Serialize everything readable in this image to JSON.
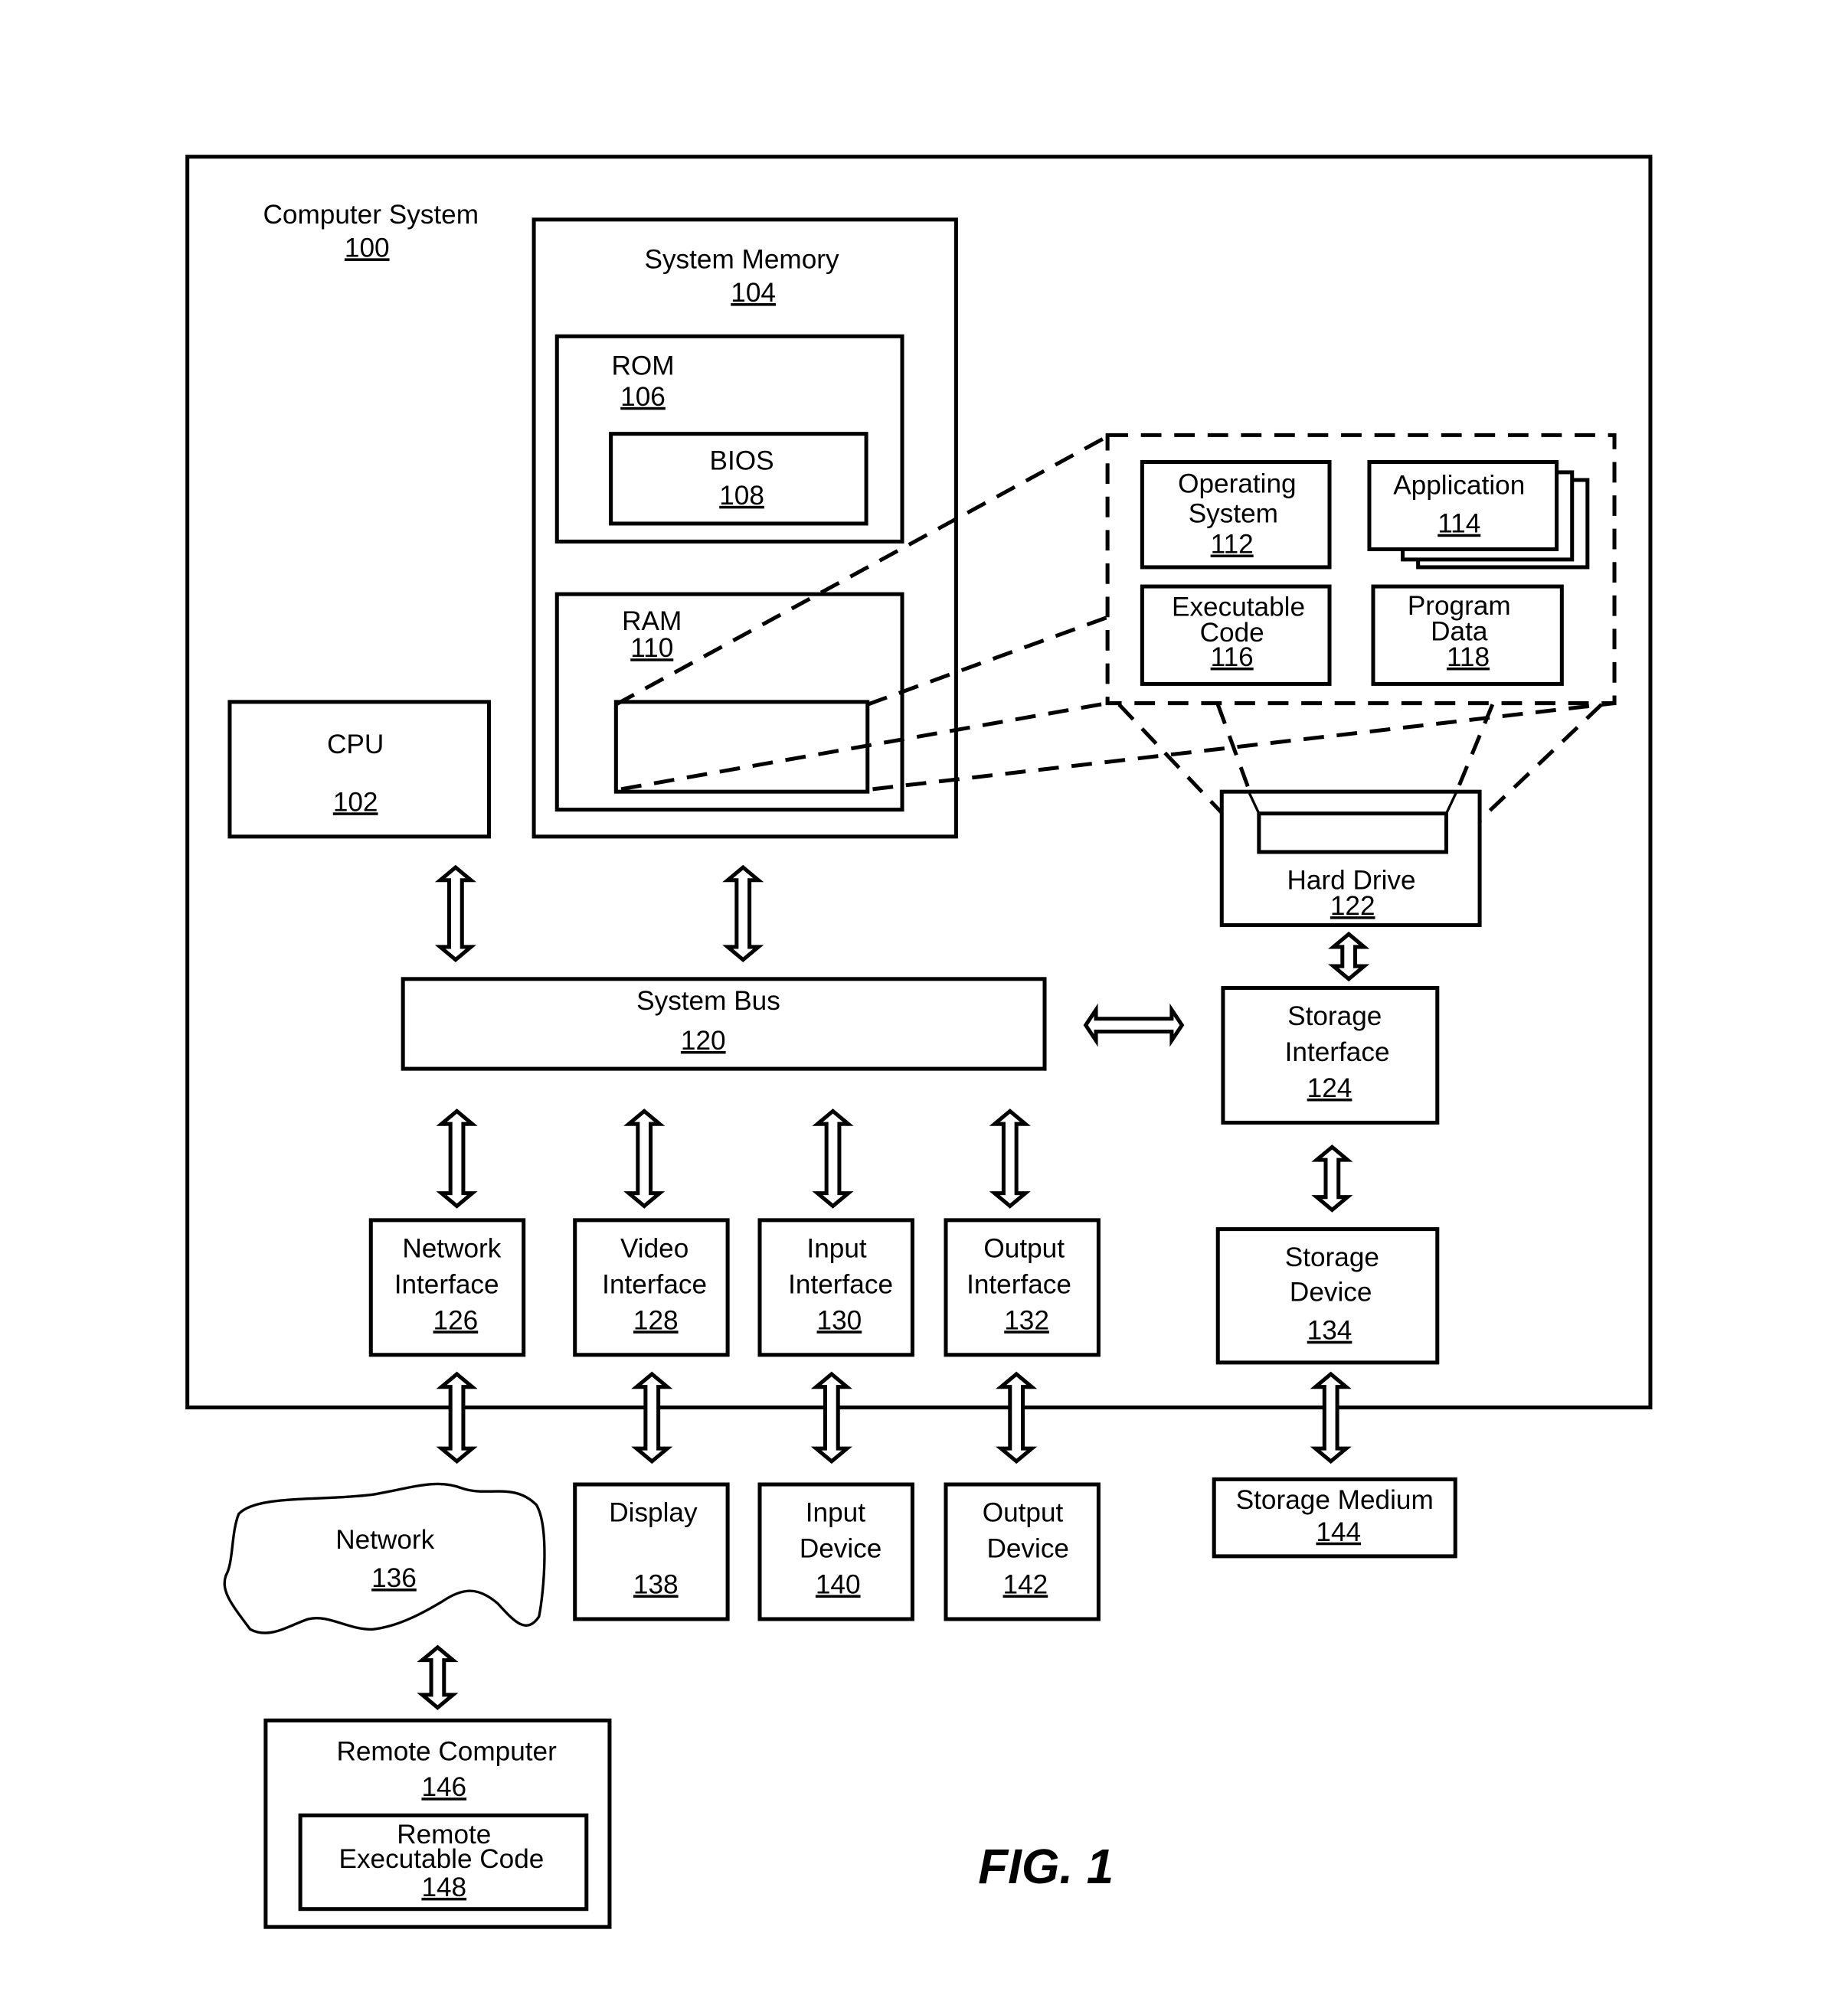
{
  "figure_label": "FIG. 1",
  "computer_system": {
    "title": "Computer System",
    "ref": "100"
  },
  "cpu": {
    "title": "CPU",
    "ref": "102"
  },
  "system_memory": {
    "title": "System Memory",
    "ref": "104"
  },
  "rom": {
    "title": "ROM",
    "ref": "106"
  },
  "bios": {
    "title": "BIOS",
    "ref": "108"
  },
  "ram": {
    "title": "RAM",
    "ref": "110"
  },
  "operating_system": {
    "line1": "Operating",
    "line2": "System",
    "ref": "112"
  },
  "application": {
    "title": "Application",
    "ref": "114"
  },
  "executable_code": {
    "line1": "Executable",
    "line2": "Code",
    "ref": "116"
  },
  "program_data": {
    "line1": "Program",
    "line2": "Data",
    "ref": "118"
  },
  "system_bus": {
    "title": "System Bus",
    "ref": "120"
  },
  "hard_drive": {
    "title": "Hard Drive",
    "ref": "122"
  },
  "storage_interface": {
    "line1": "Storage",
    "line2": "Interface",
    "ref": "124"
  },
  "network_interface": {
    "line1": "Network",
    "line2": "Interface",
    "ref": "126"
  },
  "video_interface": {
    "line1": "Video",
    "line2": "Interface",
    "ref": "128"
  },
  "input_interface": {
    "line1": "Input",
    "line2": "Interface",
    "ref": "130"
  },
  "output_interface": {
    "line1": "Output",
    "line2": "Interface",
    "ref": "132"
  },
  "storage_device": {
    "line1": "Storage",
    "line2": "Device",
    "ref": "134"
  },
  "network": {
    "title": "Network",
    "ref": "136"
  },
  "display": {
    "title": "Display",
    "ref": "138"
  },
  "input_device": {
    "line1": "Input",
    "line2": "Device",
    "ref": "140"
  },
  "output_device": {
    "line1": "Output",
    "line2": "Device",
    "ref": "142"
  },
  "storage_medium": {
    "title": "Storage Medium",
    "ref": "144"
  },
  "remote_computer": {
    "title": "Remote Computer",
    "ref": "146"
  },
  "remote_executable_code": {
    "line1": "Remote",
    "line2": "Executable Code",
    "ref": "148"
  }
}
